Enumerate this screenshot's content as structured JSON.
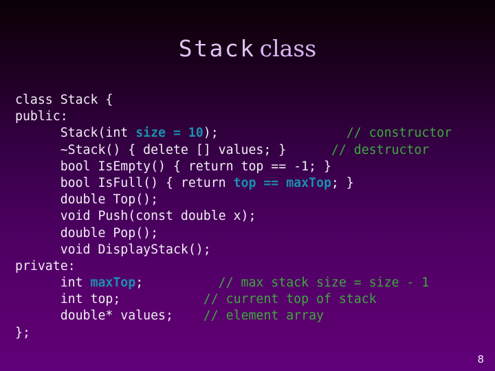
{
  "slide": {
    "title_mono": "Stack",
    "title_serif": "class",
    "page_number": "8",
    "background_top_color": "#0b0008",
    "background_bottom_color": "#60007a",
    "title_color": "#dfc4f2",
    "code_color": "#f2eef5",
    "highlight_color": "#1b8fad",
    "comment_color": "#3da83d"
  },
  "code": {
    "lines": [
      {
        "segments": [
          {
            "text": "class Stack {",
            "style": "plain"
          }
        ]
      },
      {
        "segments": [
          {
            "text": "public:",
            "style": "plain"
          }
        ]
      },
      {
        "segments": [
          {
            "text": "      Stack(int ",
            "style": "plain"
          },
          {
            "text": "size = 10",
            "style": "highlight"
          },
          {
            "text": ");",
            "style": "plain"
          },
          {
            "text": "                 ",
            "style": "plain"
          },
          {
            "text": "// constructor",
            "style": "comment"
          }
        ]
      },
      {
        "segments": [
          {
            "text": "      ~Stack() { delete [] values; }",
            "style": "plain"
          },
          {
            "text": "      ",
            "style": "plain"
          },
          {
            "text": "// destructor",
            "style": "comment"
          }
        ]
      },
      {
        "segments": [
          {
            "text": "      bool IsEmpty() { return top == -1; }",
            "style": "plain"
          }
        ]
      },
      {
        "segments": [
          {
            "text": "      bool IsFull() { return ",
            "style": "plain"
          },
          {
            "text": "top == maxTop",
            "style": "highlight"
          },
          {
            "text": "; }",
            "style": "plain"
          }
        ]
      },
      {
        "segments": [
          {
            "text": "      double Top();",
            "style": "plain"
          }
        ]
      },
      {
        "segments": [
          {
            "text": "      void Push(const double x);",
            "style": "plain"
          }
        ]
      },
      {
        "segments": [
          {
            "text": "      double Pop();",
            "style": "plain"
          }
        ]
      },
      {
        "segments": [
          {
            "text": "      void DisplayStack();",
            "style": "plain"
          }
        ]
      },
      {
        "segments": [
          {
            "text": "private:",
            "style": "plain"
          }
        ]
      },
      {
        "segments": [
          {
            "text": "      int ",
            "style": "plain"
          },
          {
            "text": "maxTop",
            "style": "highlight"
          },
          {
            "text": ";",
            "style": "plain"
          },
          {
            "text": "          ",
            "style": "plain"
          },
          {
            "text": "// max stack size = size - 1",
            "style": "comment"
          }
        ]
      },
      {
        "segments": [
          {
            "text": "      int top;",
            "style": "plain"
          },
          {
            "text": "           ",
            "style": "plain"
          },
          {
            "text": "// current top of stack",
            "style": "comment"
          }
        ]
      },
      {
        "segments": [
          {
            "text": "      double* values;",
            "style": "plain"
          },
          {
            "text": "    ",
            "style": "plain"
          },
          {
            "text": "// element array",
            "style": "comment"
          }
        ]
      },
      {
        "segments": [
          {
            "text": "};",
            "style": "plain"
          }
        ]
      }
    ]
  }
}
